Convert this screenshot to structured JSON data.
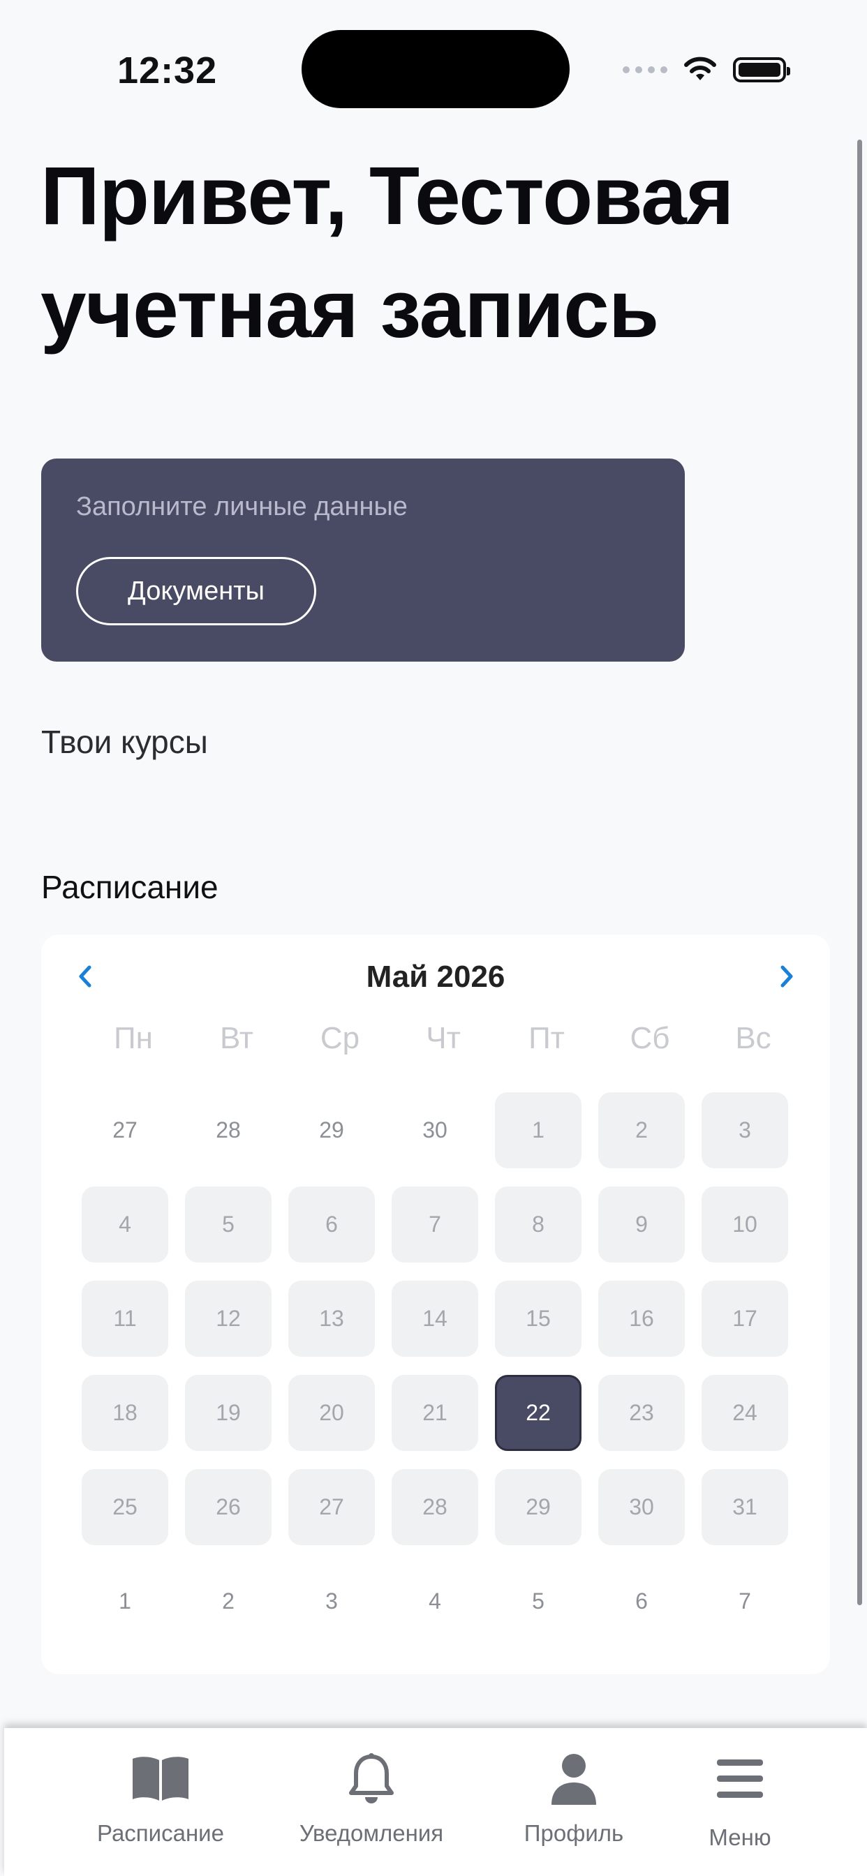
{
  "status_bar": {
    "time": "12:32"
  },
  "greeting": "Привет, Тестовая учетная запись",
  "docs_card": {
    "hint": "Заполните личные данные",
    "button": "Документы"
  },
  "courses_title": "Твои курсы",
  "schedule_title": "Расписание",
  "calendar": {
    "month_title": "Май 2026",
    "weekdays": [
      "Пн",
      "Вт",
      "Ср",
      "Чт",
      "Пт",
      "Сб",
      "Вс"
    ],
    "selected_day": "22",
    "weeks": [
      [
        {
          "d": "27",
          "s": "outside"
        },
        {
          "d": "28",
          "s": "outside"
        },
        {
          "d": "29",
          "s": "outside"
        },
        {
          "d": "30",
          "s": "outside"
        },
        {
          "d": "1",
          "s": "active"
        },
        {
          "d": "2",
          "s": "active"
        },
        {
          "d": "3",
          "s": "active"
        }
      ],
      [
        {
          "d": "4",
          "s": "active"
        },
        {
          "d": "5",
          "s": "active"
        },
        {
          "d": "6",
          "s": "active"
        },
        {
          "d": "7",
          "s": "active"
        },
        {
          "d": "8",
          "s": "active"
        },
        {
          "d": "9",
          "s": "active"
        },
        {
          "d": "10",
          "s": "active"
        }
      ],
      [
        {
          "d": "11",
          "s": "active"
        },
        {
          "d": "12",
          "s": "active"
        },
        {
          "d": "13",
          "s": "active"
        },
        {
          "d": "14",
          "s": "active"
        },
        {
          "d": "15",
          "s": "active"
        },
        {
          "d": "16",
          "s": "active"
        },
        {
          "d": "17",
          "s": "active"
        }
      ],
      [
        {
          "d": "18",
          "s": "active"
        },
        {
          "d": "19",
          "s": "active"
        },
        {
          "d": "20",
          "s": "active"
        },
        {
          "d": "21",
          "s": "active"
        },
        {
          "d": "22",
          "s": "selected"
        },
        {
          "d": "23",
          "s": "active"
        },
        {
          "d": "24",
          "s": "active"
        }
      ],
      [
        {
          "d": "25",
          "s": "active"
        },
        {
          "d": "26",
          "s": "active"
        },
        {
          "d": "27",
          "s": "active"
        },
        {
          "d": "28",
          "s": "active"
        },
        {
          "d": "29",
          "s": "active"
        },
        {
          "d": "30",
          "s": "active"
        },
        {
          "d": "31",
          "s": "active"
        }
      ],
      [
        {
          "d": "1",
          "s": "outside"
        },
        {
          "d": "2",
          "s": "outside"
        },
        {
          "d": "3",
          "s": "outside"
        },
        {
          "d": "4",
          "s": "outside"
        },
        {
          "d": "5",
          "s": "outside"
        },
        {
          "d": "6",
          "s": "outside"
        },
        {
          "d": "7",
          "s": "outside"
        }
      ]
    ]
  },
  "tabbar": {
    "items": [
      {
        "label": "Расписание",
        "icon": "book-icon"
      },
      {
        "label": "Уведомления",
        "icon": "bell-icon"
      },
      {
        "label": "Профиль",
        "icon": "person-icon"
      },
      {
        "label": "Меню",
        "icon": "menu-icon"
      }
    ]
  },
  "colors": {
    "accent": "#494a63",
    "link": "#1a7fd6",
    "icon_gray": "#6c6f76"
  }
}
